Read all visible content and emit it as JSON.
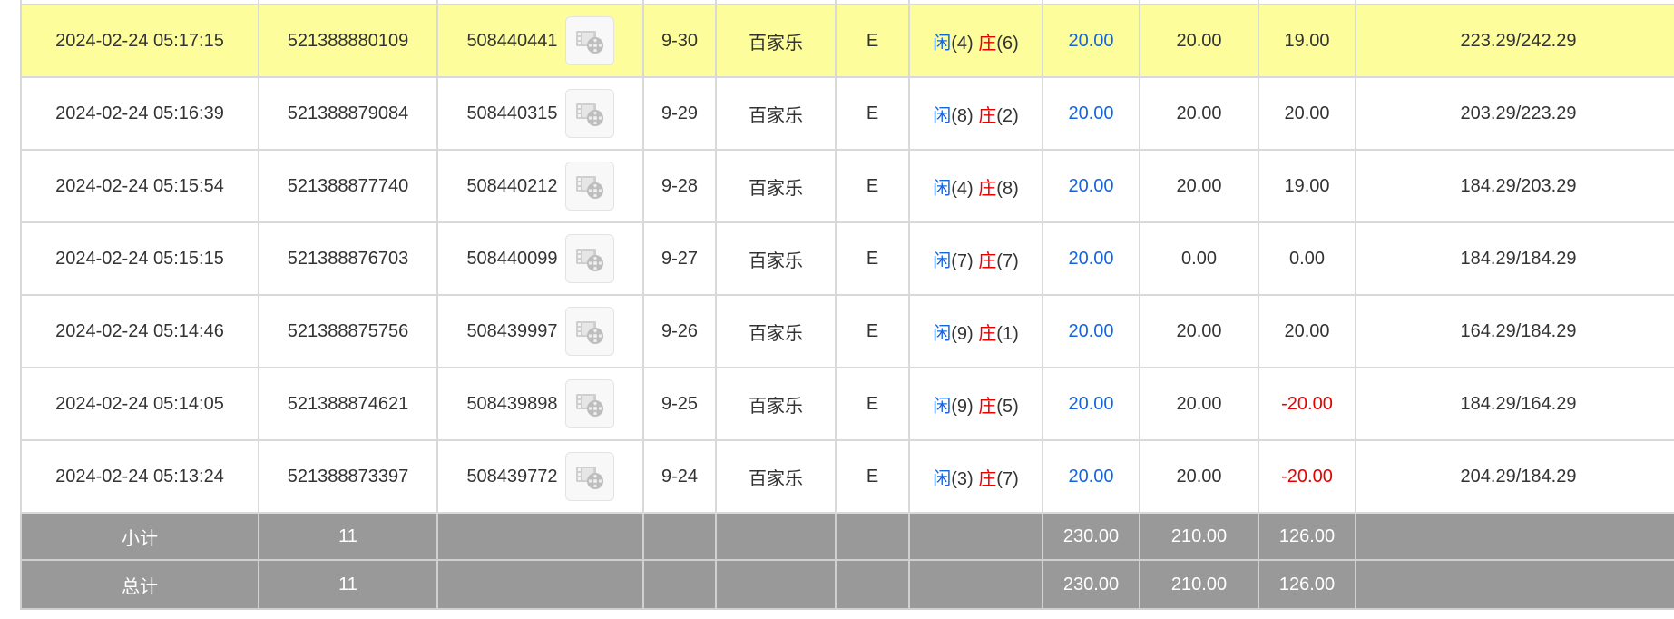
{
  "rows": [
    {
      "time": "2024-02-24 05:17:15",
      "order_no": "521388880109",
      "game_no": "508440441",
      "round": "9-30",
      "game": "百家乐",
      "table": "E",
      "result": {
        "player_label": "闲",
        "player_val": "(4)",
        "banker_label": "庄",
        "banker_val": "(6)"
      },
      "bet": "20.00",
      "valid_bet": "20.00",
      "win_loss": "19.00",
      "balance": "223.29/242.29",
      "highlight": true
    },
    {
      "time": "2024-02-24 05:16:39",
      "order_no": "521388879084",
      "game_no": "508440315",
      "round": "9-29",
      "game": "百家乐",
      "table": "E",
      "result": {
        "player_label": "闲",
        "player_val": "(8)",
        "banker_label": "庄",
        "banker_val": "(2)"
      },
      "bet": "20.00",
      "valid_bet": "20.00",
      "win_loss": "20.00",
      "balance": "203.29/223.29"
    },
    {
      "time": "2024-02-24 05:15:54",
      "order_no": "521388877740",
      "game_no": "508440212",
      "round": "9-28",
      "game": "百家乐",
      "table": "E",
      "result": {
        "player_label": "闲",
        "player_val": "(4)",
        "banker_label": "庄",
        "banker_val": "(8)"
      },
      "bet": "20.00",
      "valid_bet": "20.00",
      "win_loss": "19.00",
      "balance": "184.29/203.29"
    },
    {
      "time": "2024-02-24 05:15:15",
      "order_no": "521388876703",
      "game_no": "508440099",
      "round": "9-27",
      "game": "百家乐",
      "table": "E",
      "result": {
        "player_label": "闲",
        "player_val": "(7)",
        "banker_label": "庄",
        "banker_val": "(7)"
      },
      "bet": "20.00",
      "valid_bet": "0.00",
      "win_loss": "0.00",
      "balance": "184.29/184.29"
    },
    {
      "time": "2024-02-24 05:14:46",
      "order_no": "521388875756",
      "game_no": "508439997",
      "round": "9-26",
      "game": "百家乐",
      "table": "E",
      "result": {
        "player_label": "闲",
        "player_val": "(9)",
        "banker_label": "庄",
        "banker_val": "(1)"
      },
      "bet": "20.00",
      "valid_bet": "20.00",
      "win_loss": "20.00",
      "balance": "164.29/184.29"
    },
    {
      "time": "2024-02-24 05:14:05",
      "order_no": "521388874621",
      "game_no": "508439898",
      "round": "9-25",
      "game": "百家乐",
      "table": "E",
      "result": {
        "player_label": "闲",
        "player_val": "(9)",
        "banker_label": "庄",
        "banker_val": "(5)"
      },
      "bet": "20.00",
      "valid_bet": "20.00",
      "win_loss": "-20.00",
      "balance": "184.29/164.29",
      "negative": true
    },
    {
      "time": "2024-02-24 05:13:24",
      "order_no": "521388873397",
      "game_no": "508439772",
      "round": "9-24",
      "game": "百家乐",
      "table": "E",
      "result": {
        "player_label": "闲",
        "player_val": "(3)",
        "banker_label": "庄",
        "banker_val": "(7)"
      },
      "bet": "20.00",
      "valid_bet": "20.00",
      "win_loss": "-20.00",
      "balance": "204.29/184.29",
      "negative": true
    }
  ],
  "subtotal": {
    "label": "小计",
    "count": "11",
    "bet": "230.00",
    "valid_bet": "210.00",
    "win_loss": "126.00"
  },
  "total": {
    "label": "总计",
    "count": "11",
    "bet": "230.00",
    "valid_bet": "210.00",
    "win_loss": "126.00"
  },
  "colors": {
    "highlight_row": "#fdfd9b",
    "player": "#1565e0",
    "banker": "#e60000",
    "summary_bg": "#999999"
  },
  "icons": {
    "replay": "film-reel-icon"
  }
}
